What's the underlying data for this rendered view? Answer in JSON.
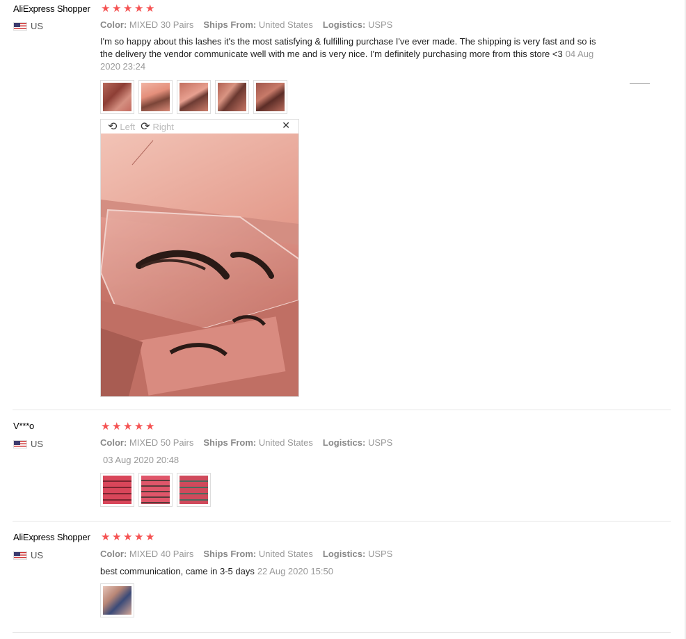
{
  "reviews": [
    {
      "user": "AliExpress Shopper",
      "country": "US",
      "stars": 5,
      "color_label": "Color:",
      "color_value": "MIXED 30 Pairs",
      "ships_label": "Ships From:",
      "ships_value": "United States",
      "logistics_label": "Logistics:",
      "logistics_value": "USPS",
      "text": "I'm so happy about this lashes it's the most satisfying & fulfilling purchase I've ever made. The shipping is very fast and so is the delivery the vendor communicate well with me and is very nice. I'm definitely purchasing more from this store <3",
      "date": "04 Aug 2020 23:24",
      "thumb_count": 5
    },
    {
      "user": "V***o",
      "country": "US",
      "stars": 5,
      "color_label": "Color:",
      "color_value": "MIXED 50 Pairs",
      "ships_label": "Ships From:",
      "ships_value": "United States",
      "logistics_label": "Logistics:",
      "logistics_value": "USPS",
      "text": "",
      "date": "03 Aug 2020 20:48",
      "thumb_count": 3
    },
    {
      "user": "AliExpress Shopper",
      "country": "US",
      "stars": 5,
      "color_label": "Color:",
      "color_value": "MIXED 40 Pairs",
      "ships_label": "Ships From:",
      "ships_value": "United States",
      "logistics_label": "Logistics:",
      "logistics_value": "USPS",
      "text": "best communication, came in 3-5 days",
      "date": "22 Aug 2020 15:50",
      "thumb_count": 1
    }
  ],
  "viewer": {
    "left_label": "Left",
    "right_label": "Right",
    "close_glyph": "✕",
    "rotate_left_icon": "rotate-left-icon",
    "rotate_right_icon": "rotate-right-icon"
  },
  "colors": {
    "star": "#f55252",
    "accent_pink": "#e8a29a"
  }
}
